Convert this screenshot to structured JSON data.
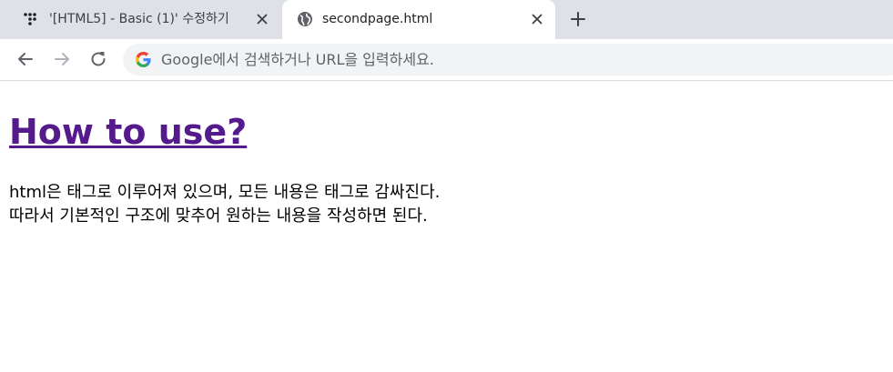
{
  "browser": {
    "tabs": [
      {
        "title": "'[HTML5] - Basic (1)' 수정하기",
        "favicon": "tistory-dots-icon",
        "active": false
      },
      {
        "title": "secondpage.html",
        "favicon": "globe-icon",
        "active": true
      }
    ],
    "omnibox": {
      "placeholder": "Google에서 검색하거나 URL을 입력하세요.",
      "icon": "google-g-icon"
    },
    "nav_icons": [
      "back-arrow-icon",
      "forward-arrow-icon",
      "reload-icon"
    ],
    "colors": {
      "tabstrip": "#dee1e6",
      "omnibox_bg": "#f1f3f4",
      "visited_link": "#551a8b"
    }
  },
  "page": {
    "heading": "How to use?",
    "paragraph_lines": [
      "html은 태그로 이루어져 있으며, 모든 내용은 태그로 감싸진다.",
      "따라서 기본적인 구조에 맞추어 원하는 내용을 작성하면 된다."
    ]
  }
}
